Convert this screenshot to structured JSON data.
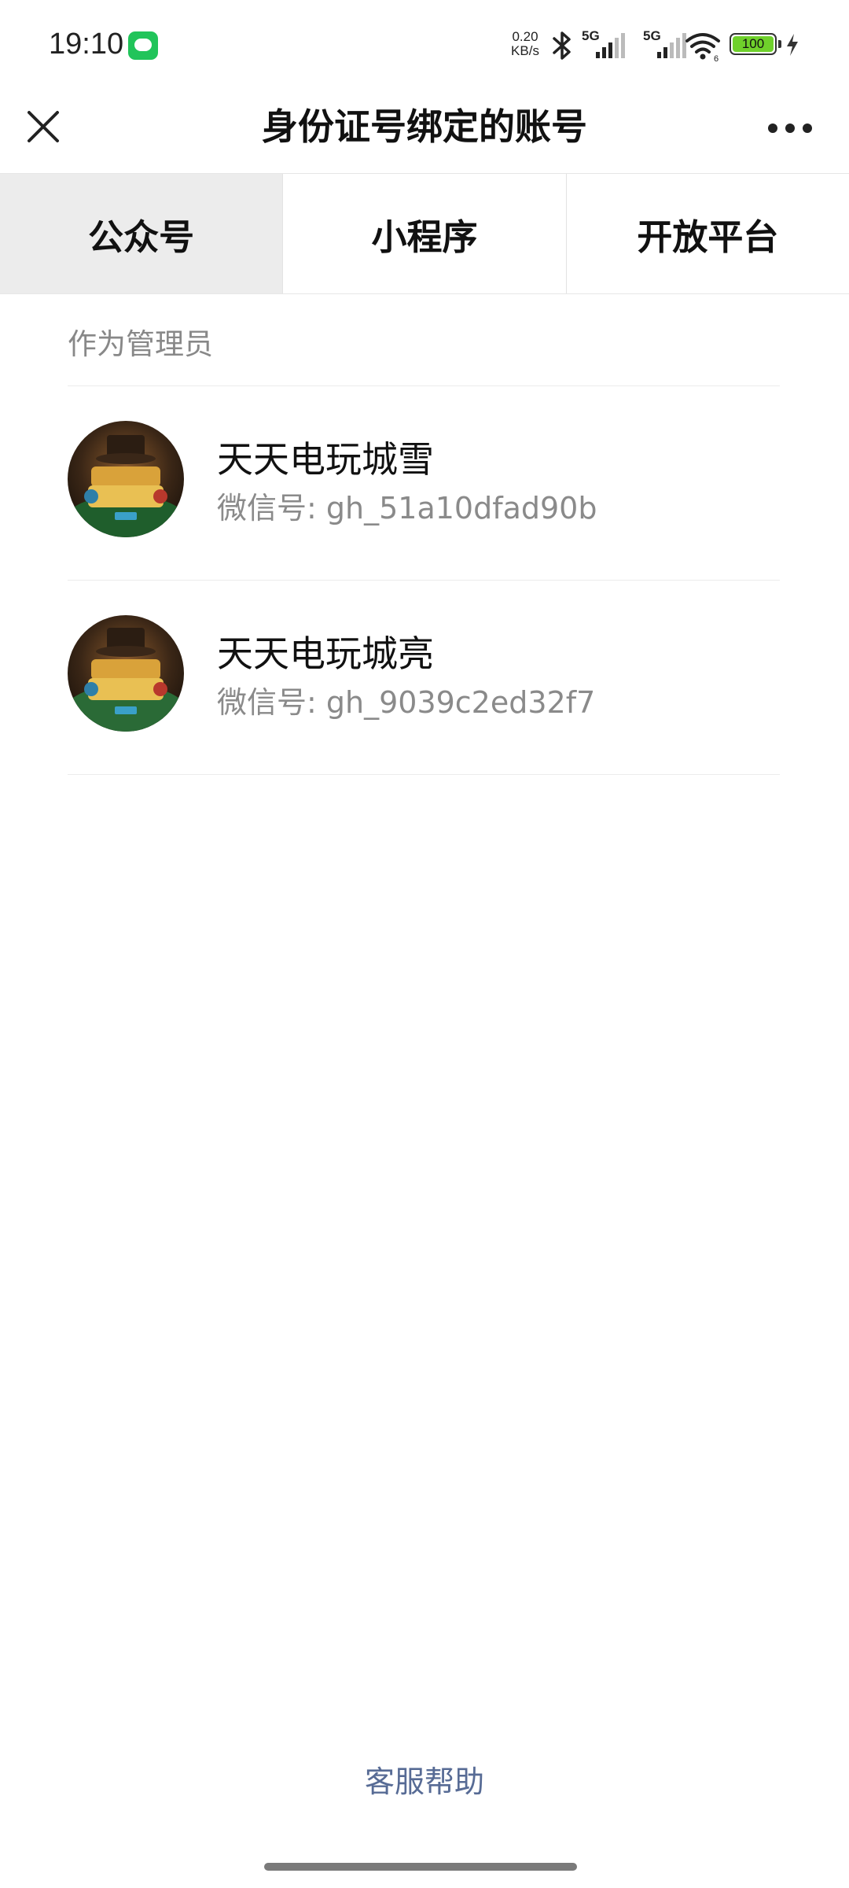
{
  "status_bar": {
    "time": "19:10",
    "net_speed_value": "0.20",
    "net_speed_unit": "KB/s",
    "signal_1_label": "5G",
    "signal_2_label": "5G",
    "wifi_label": "6",
    "battery_level": "100",
    "icons": [
      "message-icon",
      "bluetooth-icon",
      "signal-icon",
      "wifi-icon",
      "battery-icon",
      "charging-icon"
    ]
  },
  "header": {
    "title": "身份证号绑定的账号",
    "close_icon": "close-icon",
    "more_icon": "more-icon"
  },
  "tabs": [
    {
      "label": "公众号",
      "active": true
    },
    {
      "label": "小程序",
      "active": false
    },
    {
      "label": "开放平台",
      "active": false
    }
  ],
  "section": {
    "label": "作为管理员",
    "items": [
      {
        "name": "天天电玩城雪",
        "id_text": "微信号: gh_51a10dfad90b"
      },
      {
        "name": "天天电玩城亮",
        "id_text": "微信号: gh_9039c2ed32f7"
      }
    ]
  },
  "footer": {
    "help_label": "客服帮助"
  },
  "colors": {
    "link": "#576b95",
    "secondary_text": "#888888",
    "active_tab_bg": "#ececec",
    "battery": "#6fd12b"
  }
}
